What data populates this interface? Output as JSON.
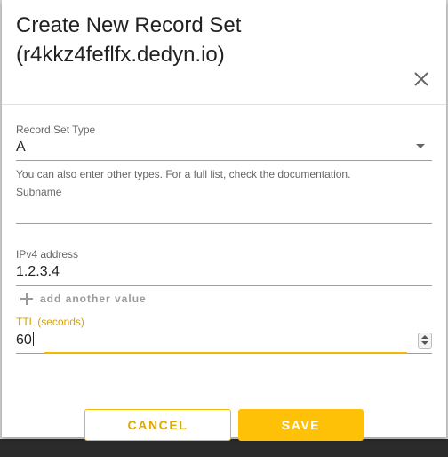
{
  "dialog": {
    "title": "Create New Record Set (r4kkz4feflfx.dedyn.io)"
  },
  "form": {
    "record_type": {
      "label": "Record Set Type",
      "value": "A",
      "hint": "You can also enter other types. For a full list, check the documentation."
    },
    "subname": {
      "label": "Subname",
      "value": ""
    },
    "ipv4": {
      "label": "IPv4 address",
      "value": "1.2.3.4",
      "add_label": "add another value"
    },
    "ttl": {
      "label": "TTL (seconds)",
      "value": "60"
    }
  },
  "actions": {
    "cancel_label": "CANCEL",
    "save_label": "SAVE"
  },
  "icons": {
    "close": "close-icon",
    "dropdown": "chevron-down-icon",
    "add": "plus-icon",
    "stepper": "stepper-icon"
  },
  "colors": {
    "accent": "#ffc107",
    "accent_text": "#e0a800",
    "focus_label": "#d4a300"
  }
}
